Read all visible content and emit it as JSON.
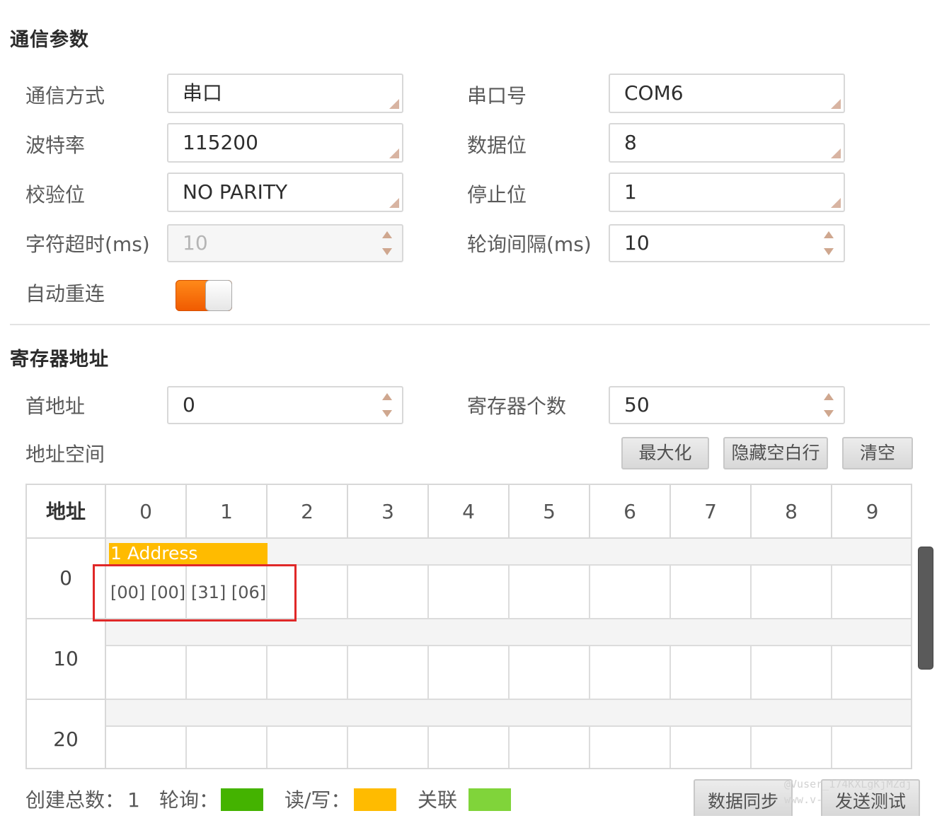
{
  "comm": {
    "title": "通信参数",
    "mode_label": "通信方式",
    "mode_value": "串口",
    "port_label": "串口号",
    "port_value": "COM6",
    "baud_label": "波特率",
    "baud_value": "115200",
    "databits_label": "数据位",
    "databits_value": "8",
    "parity_label": "校验位",
    "parity_value": "NO PARITY",
    "stopbits_label": "停止位",
    "stopbits_value": "1",
    "char_timeout_label": "字符超时(ms)",
    "char_timeout_value": "10",
    "poll_interval_label": "轮询间隔(ms)",
    "poll_interval_value": "10",
    "auto_reconnect_label": "自动重连",
    "auto_reconnect_on": true
  },
  "register": {
    "title": "寄存器地址",
    "start_label": "首地址",
    "start_value": "0",
    "count_label": "寄存器个数",
    "count_value": "50",
    "space_label": "地址空间",
    "btn_maximize": "最大化",
    "btn_hide_empty": "隐藏空白行",
    "btn_clear": "清空"
  },
  "grid": {
    "header_addr": "地址",
    "columns": [
      "0",
      "1",
      "2",
      "3",
      "4",
      "5",
      "6",
      "7",
      "8",
      "9"
    ],
    "rows": [
      "0",
      "10",
      "20"
    ],
    "tag_label": "1 Address",
    "cells": [
      "[00] [00]",
      "[31] [06]"
    ]
  },
  "footer": {
    "total_label": "创建总数：",
    "total_value": "1",
    "poll_label": "轮询：",
    "rw_label": "读/写：",
    "link_label": "关联",
    "btn_sync": "数据同步",
    "btn_test": "发送测试",
    "watermark_1": "@Vuser_174KXLgKjMZdj",
    "watermark_2": "www.v-"
  },
  "colors": {
    "poll": "#44b300",
    "rw": "#ffbb00",
    "link": "#80d43a",
    "toggle_on": "#f26200",
    "highlight": "#e02828"
  }
}
